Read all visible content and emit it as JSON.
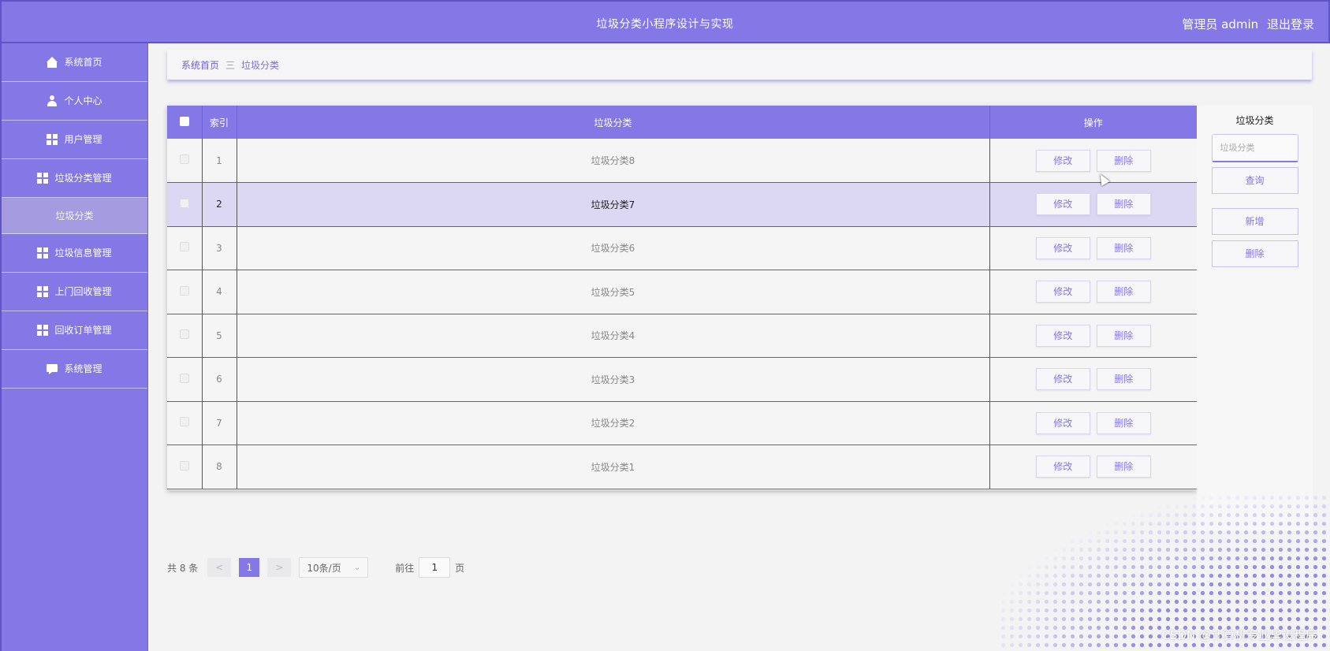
{
  "header": {
    "title": "垃圾分类小程序设计与实现",
    "user": "管理员 admin",
    "logout": "退出登录"
  },
  "sidebar": {
    "items": [
      {
        "label": "系统首页",
        "icon": "home-icon"
      },
      {
        "label": "个人中心",
        "icon": "user-icon"
      },
      {
        "label": "用户管理",
        "icon": "grid-icon"
      },
      {
        "label": "垃圾分类管理",
        "icon": "grid-icon"
      },
      {
        "label": "垃圾分类",
        "icon": ""
      },
      {
        "label": "垃圾信息管理",
        "icon": "grid-icon"
      },
      {
        "label": "上门回收管理",
        "icon": "grid-icon"
      },
      {
        "label": "回收订单管理",
        "icon": "grid-icon"
      },
      {
        "label": "系统管理",
        "icon": "chat-icon"
      }
    ]
  },
  "breadcrumb": {
    "home": "系统首页",
    "separator": "三",
    "current": "垃圾分类"
  },
  "table": {
    "headers": {
      "index": "索引",
      "category": "垃圾分类",
      "ops": "操作"
    },
    "edit_label": "修改",
    "delete_label": "删除",
    "rows": [
      {
        "index": "1",
        "name": "垃圾分类8"
      },
      {
        "index": "2",
        "name": "垃圾分类7"
      },
      {
        "index": "3",
        "name": "垃圾分类6"
      },
      {
        "index": "4",
        "name": "垃圾分类5"
      },
      {
        "index": "5",
        "name": "垃圾分类4"
      },
      {
        "index": "6",
        "name": "垃圾分类3"
      },
      {
        "index": "7",
        "name": "垃圾分类2"
      },
      {
        "index": "8",
        "name": "垃圾分类1"
      }
    ]
  },
  "search": {
    "label": "垃圾分类",
    "placeholder": "垃圾分类",
    "query": "查询",
    "add": "新增",
    "delete": "删除"
  },
  "pager": {
    "total": "共 8 条",
    "prev": "<",
    "page": "1",
    "next": ">",
    "size": "10条/页",
    "goto": "前往",
    "goto_value": "1",
    "page_unit": "页"
  },
  "watermark": "CSDN @计算机专业毕设程序",
  "colors": {
    "accent": "#8478e6",
    "highlight_row": "#dcd8f3"
  }
}
